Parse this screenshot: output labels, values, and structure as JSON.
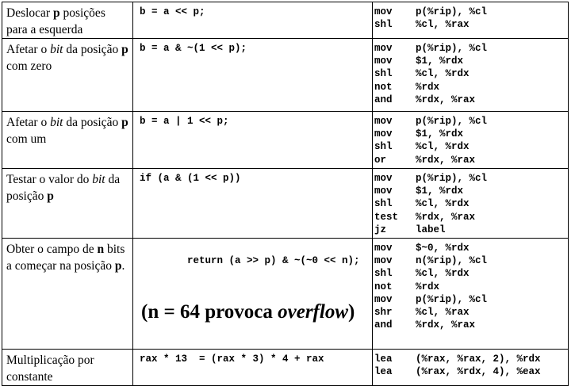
{
  "rows": [
    {
      "desc": [
        {
          "t": "Deslocar ",
          "s": ""
        },
        {
          "t": "p",
          "s": "b"
        },
        {
          "t": " posições para a esquerda",
          "s": ""
        }
      ],
      "code": "b = a << p;",
      "asm": [
        {
          "op": "mov",
          "args": "p(%rip), %cl"
        },
        {
          "op": "shl",
          "args": "%cl, %rax"
        }
      ]
    },
    {
      "desc": [
        {
          "t": "Afetar o ",
          "s": ""
        },
        {
          "t": "bit",
          "s": "i"
        },
        {
          "t": " da posição ",
          "s": ""
        },
        {
          "t": "p",
          "s": "b"
        },
        {
          "t": " com zero",
          "s": ""
        }
      ],
      "code": "b = a & ~(1 << p);",
      "asm": [
        {
          "op": "mov",
          "args": "p(%rip), %cl"
        },
        {
          "op": "mov",
          "args": "$1, %rdx"
        },
        {
          "op": "shl",
          "args": "%cl, %rdx"
        },
        {
          "op": "not",
          "args": "%rdx"
        },
        {
          "op": "and",
          "args": "%rdx, %rax"
        }
      ]
    },
    {
      "desc": [
        {
          "t": "Afetar o ",
          "s": ""
        },
        {
          "t": "bit",
          "s": "i"
        },
        {
          "t": " da posição ",
          "s": ""
        },
        {
          "t": "p",
          "s": "b"
        },
        {
          "t": " com um",
          "s": ""
        }
      ],
      "code": "b = a | 1 << p;",
      "asm": [
        {
          "op": "mov",
          "args": "p(%rip), %cl"
        },
        {
          "op": "mov",
          "args": "$1, %rdx"
        },
        {
          "op": "shl",
          "args": "%cl, %rdx"
        },
        {
          "op": "or",
          "args": "%rdx, %rax"
        }
      ]
    },
    {
      "desc": [
        {
          "t": "Testar o valor do ",
          "s": ""
        },
        {
          "t": "bit",
          "s": "i"
        },
        {
          "t": " da posição ",
          "s": ""
        },
        {
          "t": "p",
          "s": "b"
        }
      ],
      "code": "if (a & (1 << p))",
      "asm": [
        {
          "op": "mov",
          "args": "p(%rip), %cl"
        },
        {
          "op": "mov",
          "args": "$1, %rdx"
        },
        {
          "op": "shl",
          "args": "%cl, %rdx"
        },
        {
          "op": "test",
          "args": "%rdx, %rax"
        },
        {
          "op": "jz",
          "args": "label"
        }
      ]
    },
    {
      "desc": [
        {
          "t": "Obter o campo de ",
          "s": ""
        },
        {
          "t": "n",
          "s": "b"
        },
        {
          "t": " bits a começar na posição ",
          "s": ""
        },
        {
          "t": "p",
          "s": "b"
        },
        {
          "t": ".",
          "s": ""
        }
      ],
      "code": "return (a >> p) & ~(~0 << n);",
      "note": [
        {
          "t": "(n = 64 provoca ",
          "s": ""
        },
        {
          "t": "overflow",
          "s": "i"
        },
        {
          "t": ")",
          "s": ""
        }
      ],
      "asm": [
        {
          "op": "mov",
          "args": "$~0, %rdx"
        },
        {
          "op": "mov",
          "args": "n(%rip), %cl"
        },
        {
          "op": "shl",
          "args": "%cl, %rdx"
        },
        {
          "op": "not",
          "args": "%rdx"
        },
        {
          "op": "mov",
          "args": "p(%rip), %cl"
        },
        {
          "op": "shr",
          "args": "%cl, %rax"
        },
        {
          "op": "and",
          "args": "%rdx, %rax"
        }
      ]
    },
    {
      "desc": [
        {
          "t": "Multiplicação por constante",
          "s": ""
        }
      ],
      "code": "rax * 13  = (rax * 3) * 4 + rax",
      "asm": [
        {
          "op": "lea",
          "args": "(%rax, %rax, 2), %rdx"
        },
        {
          "op": "lea",
          "args": "(%rax, %rdx, 4), %eax"
        }
      ]
    }
  ]
}
